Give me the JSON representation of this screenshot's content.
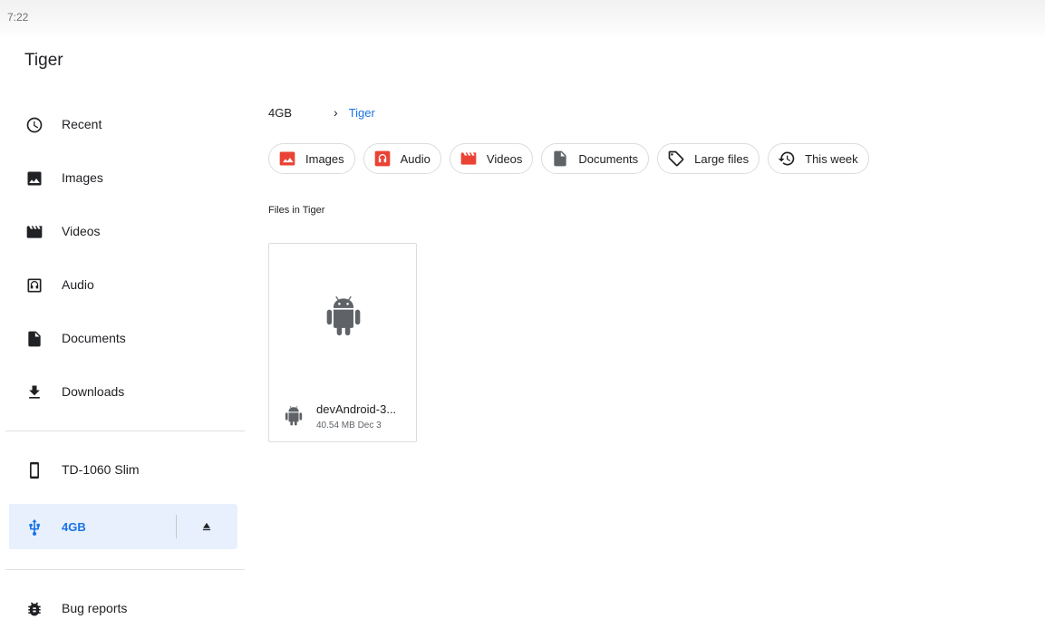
{
  "status_bar": {
    "time": "7:22"
  },
  "app": {
    "title": "Tiger"
  },
  "sidebar": {
    "items": [
      {
        "label": "Recent",
        "icon": "clock-icon"
      },
      {
        "label": "Images",
        "icon": "image-icon"
      },
      {
        "label": "Videos",
        "icon": "movie-icon"
      },
      {
        "label": "Audio",
        "icon": "audio-icon"
      },
      {
        "label": "Documents",
        "icon": "document-icon"
      },
      {
        "label": "Downloads",
        "icon": "download-icon"
      }
    ],
    "devices": [
      {
        "label": "TD-1060 Slim",
        "icon": "phone-icon"
      },
      {
        "label": "4GB",
        "icon": "usb-icon",
        "active": true
      }
    ],
    "extras": [
      {
        "label": "Bug reports",
        "icon": "bug-icon"
      }
    ]
  },
  "breadcrumb": {
    "root": "4GB",
    "current": "Tiger"
  },
  "chips": [
    {
      "label": "Images",
      "icon": "image-icon"
    },
    {
      "label": "Audio",
      "icon": "audio-icon"
    },
    {
      "label": "Videos",
      "icon": "movie-icon"
    },
    {
      "label": "Documents",
      "icon": "document-icon"
    },
    {
      "label": "Large files",
      "icon": "tag-icon"
    },
    {
      "label": "This week",
      "icon": "history-icon"
    }
  ],
  "section": {
    "label": "Files in Tiger"
  },
  "files": [
    {
      "name": "devAndroid-3...",
      "size": "40.54 MB",
      "date": "Dec 3",
      "meta": "40.54 MB Dec 3",
      "icon": "android-icon"
    }
  ],
  "colors": {
    "accent": "#1a73e8",
    "active_bg": "#e8f0fe",
    "chip_red": "#ea4335",
    "text": "#202124"
  }
}
